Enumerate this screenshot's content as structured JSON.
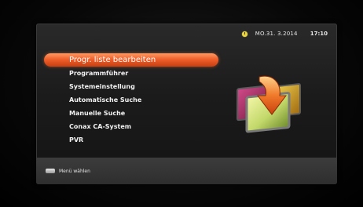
{
  "status": {
    "date": "MO.31. 3.2014",
    "time": "17:10"
  },
  "menu": {
    "items": [
      {
        "label": "Progr. liste bearbeiten",
        "selected": true
      },
      {
        "label": "Programmführer",
        "selected": false
      },
      {
        "label": "Systemeinstellung",
        "selected": false
      },
      {
        "label": "Automatische Suche",
        "selected": false
      },
      {
        "label": "Manuelle Suche",
        "selected": false
      },
      {
        "label": "Conax CA-System",
        "selected": false
      },
      {
        "label": "PVR",
        "selected": false
      }
    ]
  },
  "footer": {
    "hint": "Menü wählen"
  },
  "colors": {
    "highlight": "#f0602b",
    "clock": "#e8d43a",
    "footer_bg": "#333333"
  },
  "icons": {
    "clock": "clock-icon",
    "illustration": "program-list-edit-icon",
    "ok_key": "ok-key-icon"
  }
}
